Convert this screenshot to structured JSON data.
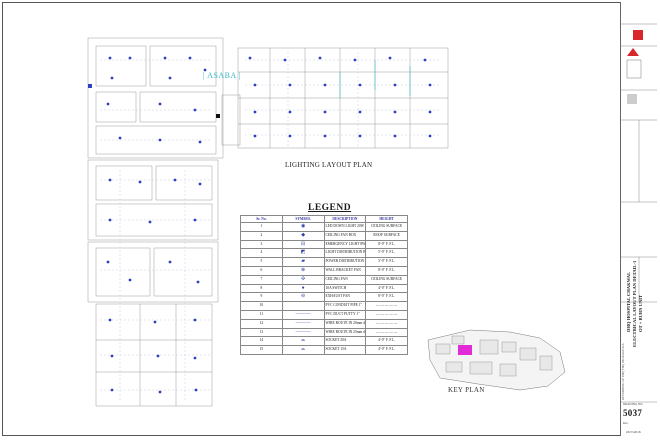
{
  "sheet": {
    "plan_title": "LIGHTING LAYOUT PLAN",
    "ward_label": "| ASABA |",
    "key_plan_title": "KEY PLAN"
  },
  "legend": {
    "title": "LEGEND",
    "headers": [
      "Sr. No.",
      "SYMBOL",
      "DESCRIPTION",
      "HEIGHT"
    ],
    "rows": [
      {
        "no": "1",
        "symbol": "◉",
        "desc": "LED DOWN LIGHT 20W",
        "height": "CEILING SURFACE"
      },
      {
        "no": "2",
        "symbol": "◆",
        "desc": "CEILING FAN BOX",
        "height": "ROOF SURFACE"
      },
      {
        "no": "3",
        "symbol": "⊟",
        "desc": "EMERGENCY LIGHT 8W",
        "height": "8'-0\" F. F.L."
      },
      {
        "no": "4",
        "symbol": "◩",
        "desc": "LIGHT DISTRIBUTION BOARD",
        "height": "5'-0\" F. F.L."
      },
      {
        "no": "5",
        "symbol": "▰",
        "desc": "POWER DISTRIBUTION BOARD",
        "height": "5'-0\" F. F.L."
      },
      {
        "no": "6",
        "symbol": "⊗",
        "desc": "WALL BRACKET FAN",
        "height": "8'-0\" F. F.L."
      },
      {
        "no": "7",
        "symbol": "✣",
        "desc": "CEILING FAN",
        "height": "CEILING SURFACE"
      },
      {
        "no": "8",
        "symbol": "●",
        "desc": "10A SWITCH",
        "height": "4'-0\" F. F.L."
      },
      {
        "no": "9",
        "symbol": "⊖",
        "desc": "EXHAUST FAN",
        "height": "8'-0\" F. F.L."
      },
      {
        "no": "10",
        "symbol": "",
        "desc": "PVC CONDUIT PIPE 1\"",
        "height": "— — — — —"
      },
      {
        "no": "11",
        "symbol": "———",
        "desc": "PVC DUCT PUTTY 1\"",
        "height": "— — — — —"
      },
      {
        "no": "12",
        "symbol": "———",
        "desc": "WIRE ROUTE IN 20mm dia CONDUIT",
        "height": "— — — — —"
      },
      {
        "no": "13",
        "symbol": "———",
        "desc": "WIRE ROUTE IN 25mm dia CONDUIT",
        "height": "— — — — —"
      },
      {
        "no": "14",
        "symbol": "⌓",
        "desc": "SOCKET 20A",
        "height": "4'-0\" F. F.L."
      },
      {
        "no": "15",
        "symbol": "⌓",
        "desc": "SOCKET 15A",
        "height": "4'-0\" F. F.L."
      }
    ]
  },
  "titleblock": {
    "project": "DHQ HOSPITAL CHAKWAL",
    "sheet_name": "ELECTRICAL LAYOUT PLAN DETAIL-1",
    "unit": "OT + BURN UNIT",
    "remark": "REVAMPING OF DHQ THQ PACKAGE 01A",
    "drawing_label": "DRAWING NO.",
    "drawing_no": "5037",
    "date": "OCT,2016",
    "rev_label": "Rev."
  },
  "colors": {
    "fixture_blue": "#2f3fbf",
    "accent_teal": "#38b7c8",
    "key_highlight": "#e02bd6",
    "logo_red": "#d8262a"
  }
}
